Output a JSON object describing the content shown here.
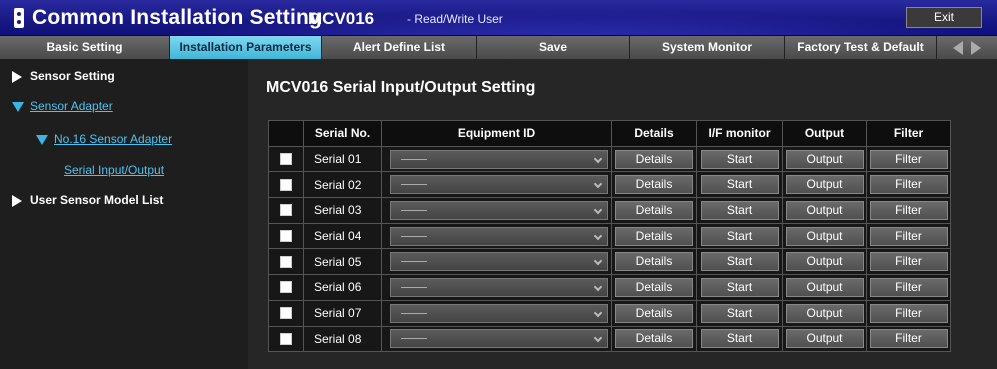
{
  "header": {
    "app_title": "Common Installation Setting",
    "device_name": "MCV016",
    "user_role": "- Read/Write User",
    "exit_label": "Exit"
  },
  "tabs": [
    {
      "label": "Basic Setting",
      "active": false
    },
    {
      "label": "Installation Parameters",
      "active": true
    },
    {
      "label": "Alert Define List",
      "active": false
    },
    {
      "label": "Save",
      "active": false
    },
    {
      "label": "System Monitor",
      "active": false
    },
    {
      "label": "Factory Test & Default",
      "active": false
    }
  ],
  "sidebar": {
    "items": [
      {
        "label": "Sensor Setting",
        "icon": "triangle-right-icon"
      },
      {
        "label": "Sensor Adapter",
        "icon": "triangle-down-icon"
      },
      {
        "label": "No.16 Sensor Adapter",
        "icon": "triangle-down-icon"
      },
      {
        "label": "Serial Input/Output",
        "icon": null
      },
      {
        "label": "User Sensor Model List",
        "icon": "triangle-right-icon"
      }
    ]
  },
  "main": {
    "title": "MCV016 Serial Input/Output Setting",
    "columns": [
      "",
      "Serial No.",
      "Equipment ID",
      "Details",
      "I/F monitor",
      "Output",
      "Filter"
    ],
    "rows": [
      {
        "serial": "Serial 01",
        "equipment": "-----",
        "details": "Details",
        "monitor": "Start",
        "output": "Output",
        "filter": "Filter"
      },
      {
        "serial": "Serial 02",
        "equipment": "-----",
        "details": "Details",
        "monitor": "Start",
        "output": "Output",
        "filter": "Filter"
      },
      {
        "serial": "Serial 03",
        "equipment": "-----",
        "details": "Details",
        "monitor": "Start",
        "output": "Output",
        "filter": "Filter"
      },
      {
        "serial": "Serial 04",
        "equipment": "-----",
        "details": "Details",
        "monitor": "Start",
        "output": "Output",
        "filter": "Filter"
      },
      {
        "serial": "Serial 05",
        "equipment": "-----",
        "details": "Details",
        "monitor": "Start",
        "output": "Output",
        "filter": "Filter"
      },
      {
        "serial": "Serial 06",
        "equipment": "-----",
        "details": "Details",
        "monitor": "Start",
        "output": "Output",
        "filter": "Filter"
      },
      {
        "serial": "Serial 07",
        "equipment": "-----",
        "details": "Details",
        "monitor": "Start",
        "output": "Output",
        "filter": "Filter"
      },
      {
        "serial": "Serial 08",
        "equipment": "-----",
        "details": "Details",
        "monitor": "Start",
        "output": "Output",
        "filter": "Filter"
      }
    ]
  },
  "colors": {
    "title_bar": "#1a1a88",
    "active_tab": "#3fb7d9",
    "link": "#4fc3f0",
    "background": "#1c1c1c"
  }
}
